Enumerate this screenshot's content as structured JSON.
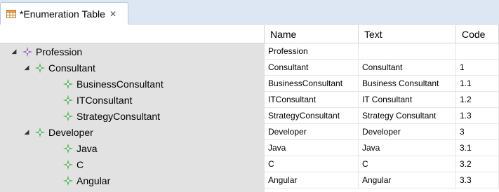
{
  "tab": {
    "title": "*Enumeration Table",
    "close_glyph": "✕",
    "icon": "table-icon"
  },
  "columns": {
    "name": "Name",
    "text": "Text",
    "code": "Code"
  },
  "rows": [
    {
      "label": "Profession",
      "name": "Profession",
      "text": "",
      "code": "",
      "expanded": true,
      "icon": "purple-star-icon"
    },
    {
      "label": "Consultant",
      "name": "Consultant",
      "text": "Consultant",
      "code": "1",
      "expanded": true,
      "icon": "green-star-icon"
    },
    {
      "label": "BusinessConsultant",
      "name": "BusinessConsultant",
      "text": "Business Consultant",
      "code": "1.1",
      "icon": "green-star-icon"
    },
    {
      "label": "ITConsultant",
      "name": "ITConsultant",
      "text": "IT Consultant",
      "code": "1.2",
      "icon": "green-star-icon"
    },
    {
      "label": "StrategyConsultant",
      "name": "StrategyConsultant",
      "text": "Strategy Consultant",
      "code": "1.3",
      "icon": "green-star-icon"
    },
    {
      "label": "Developer",
      "name": "Developer",
      "text": "Developer",
      "code": "3",
      "expanded": true,
      "icon": "green-star-icon"
    },
    {
      "label": "Java",
      "name": "Java",
      "text": "Java",
      "code": "3.1",
      "icon": "green-star-icon"
    },
    {
      "label": "C",
      "name": "C",
      "text": "C",
      "code": "3.2",
      "icon": "green-star-icon"
    },
    {
      "label": "Angular",
      "name": "Angular",
      "text": "Angular",
      "code": "3.3",
      "icon": "green-star-icon"
    }
  ],
  "colors": {
    "purple_star": "#9a5fc4",
    "green_star": "#4caf50",
    "tree_bg": "#e2e2e2",
    "tabbar_bg": "#dde6f3"
  }
}
